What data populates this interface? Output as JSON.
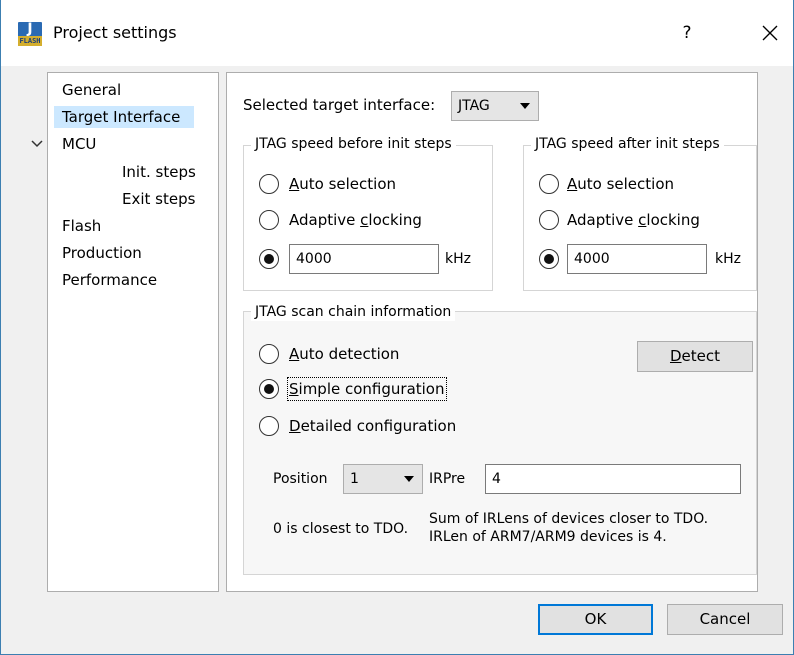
{
  "window": {
    "title": "Project settings",
    "icon_text_top": "J",
    "icon_text_bottom": "FLASH",
    "help_label": "?",
    "close_icon": "close-icon"
  },
  "nav": {
    "items": [
      {
        "label": "General",
        "selected": false
      },
      {
        "label": "Target Interface",
        "selected": true
      },
      {
        "label": "MCU",
        "selected": false,
        "expanded": true
      },
      {
        "label": "Init. steps",
        "selected": false
      },
      {
        "label": "Exit steps",
        "selected": false
      },
      {
        "label": "Flash",
        "selected": false
      },
      {
        "label": "Production",
        "selected": false
      },
      {
        "label": "Performance",
        "selected": false
      }
    ]
  },
  "target": {
    "label": "Selected target interface:",
    "value": "JTAG"
  },
  "speed_before": {
    "title": "JTAG speed before init steps",
    "auto_prefix": "",
    "auto_u": "A",
    "auto_rest": "uto selection",
    "adaptive_prefix": "Adaptive ",
    "adaptive_u": "c",
    "adaptive_rest": "locking",
    "value": "4000",
    "unit": "kHz",
    "selected": "manual"
  },
  "speed_after": {
    "title": "JTAG speed after init steps",
    "auto_prefix": "",
    "auto_u": "A",
    "auto_rest": "uto selection",
    "adaptive_prefix": "Adaptive ",
    "adaptive_u": "c",
    "adaptive_rest": "locking",
    "value": "4000",
    "unit": "kHz",
    "selected": "manual"
  },
  "scan_chain": {
    "title": "JTAG scan chain information",
    "auto_u": "A",
    "auto_rest": "uto detection",
    "simple_u": "S",
    "simple_rest": "imple configuration",
    "detailed_u": "D",
    "detailed_rest": "etailed configuration",
    "selected": "simple",
    "detect_u": "D",
    "detect_rest": "etect",
    "position_label": "Position",
    "position_value": "1",
    "irpre_label": "IRPre",
    "irpre_value": "4",
    "note_position": "0 is closest to TDO.",
    "note_irpre_line1": "Sum of IRLens of devices closer to TDO.",
    "note_irpre_line2": "IRLen of ARM7/ARM9 devices is 4."
  },
  "buttons": {
    "ok": "OK",
    "cancel": "Cancel"
  }
}
